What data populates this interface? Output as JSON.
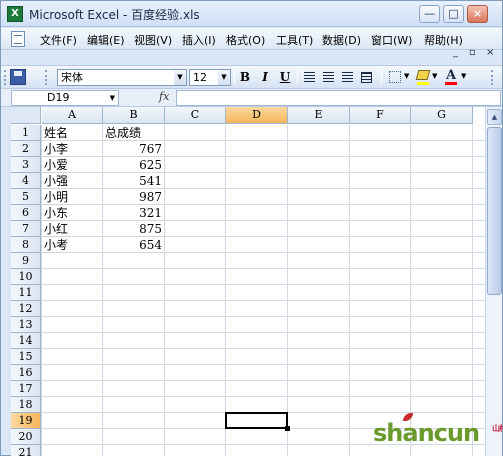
{
  "window": {
    "title": "Microsoft Excel - 百度经验.xls",
    "app_icon_text": "X",
    "buttons": {
      "minimize": "—",
      "maximize": "□",
      "close": "×"
    }
  },
  "menubar": {
    "items": [
      "文件(F)",
      "编辑(E)",
      "视图(V)",
      "插入(I)",
      "格式(O)",
      "工具(T)",
      "数据(D)",
      "窗口(W)",
      "帮助(H)"
    ],
    "mdi": {
      "minimize": "_",
      "restore": "▫",
      "close": "×"
    }
  },
  "toolbar": {
    "font_name": "宋体",
    "font_size": "12",
    "bold": "B",
    "italic": "I",
    "underline": "U",
    "font_color_letter": "A",
    "colors": {
      "fill": "#ffff00",
      "font": "#ff0000"
    }
  },
  "formulabar": {
    "name_box": "D19",
    "fx_label": "fx",
    "formula": ""
  },
  "sheet": {
    "columns": [
      "A",
      "B",
      "C",
      "D",
      "E",
      "F",
      "G"
    ],
    "active_column": "D",
    "rows": [
      "1",
      "2",
      "3",
      "4",
      "5",
      "6",
      "7",
      "8",
      "9",
      "10",
      "11",
      "12",
      "13",
      "14",
      "15",
      "16",
      "17",
      "18",
      "19",
      "20",
      "21"
    ],
    "active_row": "19",
    "data": [
      {
        "a": "姓名",
        "b": "总成绩"
      },
      {
        "a": "小李",
        "b": "767"
      },
      {
        "a": "小爱",
        "b": "625"
      },
      {
        "a": "小强",
        "b": "541"
      },
      {
        "a": "小明",
        "b": "987"
      },
      {
        "a": "小东",
        "b": "321"
      },
      {
        "a": "小红",
        "b": "875"
      },
      {
        "a": "小考",
        "b": "654"
      }
    ]
  },
  "watermark": {
    "text": "shancun",
    "sub": "山村网"
  }
}
